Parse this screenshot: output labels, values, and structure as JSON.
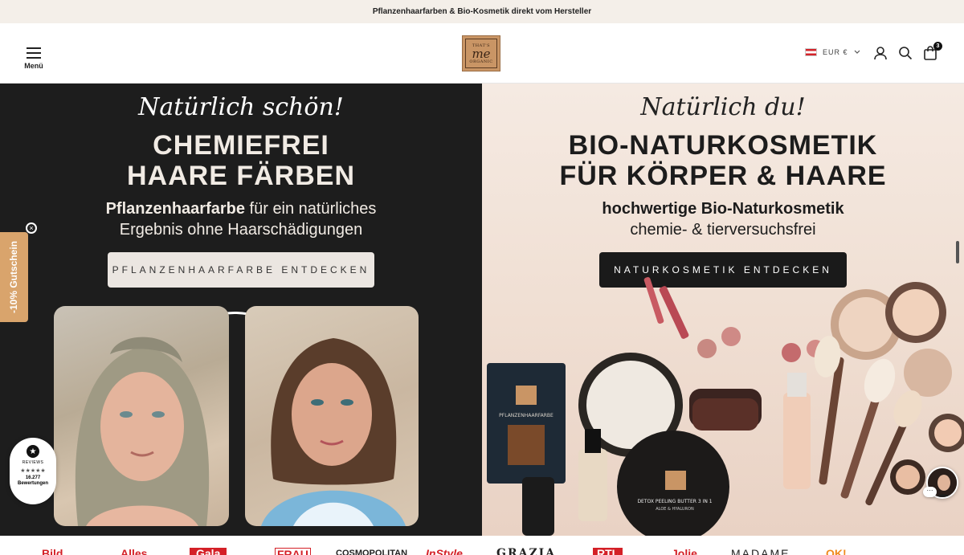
{
  "announcement": "Pflanzenhaarfarben & Bio-Kosmetik direkt vom Hersteller",
  "header": {
    "menu_label": "Menü",
    "logo": {
      "line1": "THAT'S",
      "line2": "me",
      "line3": "ORGANIC"
    },
    "currency": "EUR €",
    "cart_count": "3"
  },
  "hero_left": {
    "script": "Natürlich schön!",
    "title_line1": "CHEMIEFREI",
    "title_line2": "HAARE FÄRBEN",
    "sub_bold": "Pflanzenhaarfarbe",
    "sub_rest": " für ein natürliches",
    "sub_line2": "Ergebnis ohne Haarschädigungen",
    "cta": "PFLANZENHAARFARBE ENTDECKEN"
  },
  "hero_right": {
    "script": "Natürlich du!",
    "title_line1": "BIO-NATURKOSMETIK",
    "title_line2": "FÜR KÖRPER & HAARE",
    "sub_line1": "hochwertige Bio-Naturkosmetik",
    "sub_line2": "chemie- & tierversuchsfrei",
    "cta": "NATURKOSMETIK ENTDECKEN",
    "products": {
      "bag_brand": "PFLANZENHAARFARBE",
      "jar_label": "DETOX PEELING BUTTER 3 IN 1",
      "jar_sub": "ALOE & HYALURON"
    }
  },
  "side_tab": {
    "label": "-10% Gutschein",
    "close": "×"
  },
  "reviews": {
    "name": "REVIEWS",
    "stars": "★★★★★",
    "count": "16.277",
    "count_label": "Bewertungen"
  },
  "press": [
    "Bild",
    "Alles",
    "Gala",
    "FRAU",
    "COSMOPOLITAN",
    "InStyle",
    "GRAZIA",
    "RTL",
    "Jolie",
    "MADAME",
    "OK!"
  ],
  "colors": {
    "accent": "#d9a46c",
    "dark_hero": "#1d1d1d",
    "announce_bg": "#f4efe9"
  }
}
